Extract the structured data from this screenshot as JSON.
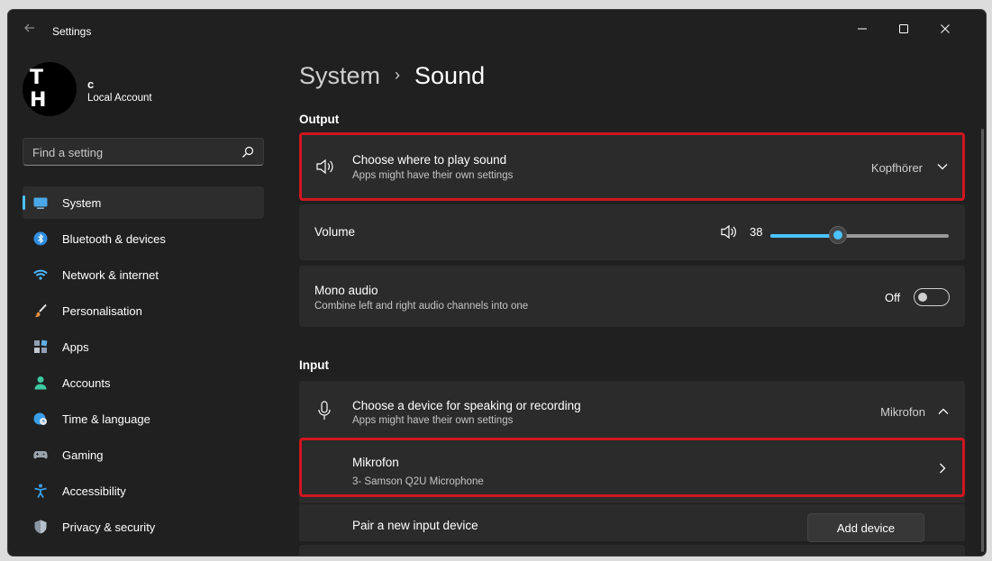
{
  "window": {
    "title": "Settings"
  },
  "user": {
    "initials": "T H",
    "name": "c",
    "account_type": "Local Account"
  },
  "search": {
    "placeholder": "Find a setting"
  },
  "sidebar": {
    "items": [
      {
        "label": "System",
        "active": true
      },
      {
        "label": "Bluetooth & devices"
      },
      {
        "label": "Network & internet"
      },
      {
        "label": "Personalisation"
      },
      {
        "label": "Apps"
      },
      {
        "label": "Accounts"
      },
      {
        "label": "Time & language"
      },
      {
        "label": "Gaming"
      },
      {
        "label": "Accessibility"
      },
      {
        "label": "Privacy & security"
      }
    ]
  },
  "breadcrumb": {
    "parent": "System",
    "current": "Sound"
  },
  "output": {
    "header": "Output",
    "choose": {
      "title": "Choose where to play sound",
      "subtitle": "Apps might have their own settings",
      "value": "Kopfhörer"
    },
    "volume": {
      "label": "Volume",
      "value": "38",
      "level": 38
    },
    "mono": {
      "title": "Mono audio",
      "subtitle": "Combine left and right audio channels into one",
      "state": "Off"
    }
  },
  "input": {
    "header": "Input",
    "choose": {
      "title": "Choose a device for speaking or recording",
      "subtitle": "Apps might have their own settings",
      "value": "Mikrofon"
    },
    "device": {
      "name": "Mikrofon",
      "detail": "3- Samson Q2U Microphone"
    },
    "pair": {
      "label": "Pair a new input device",
      "button": "Add device"
    }
  },
  "colors": {
    "accent": "#4cc2ff",
    "highlight_border": "#d0161f",
    "background": "#202020",
    "card": "#2b2b2b"
  }
}
